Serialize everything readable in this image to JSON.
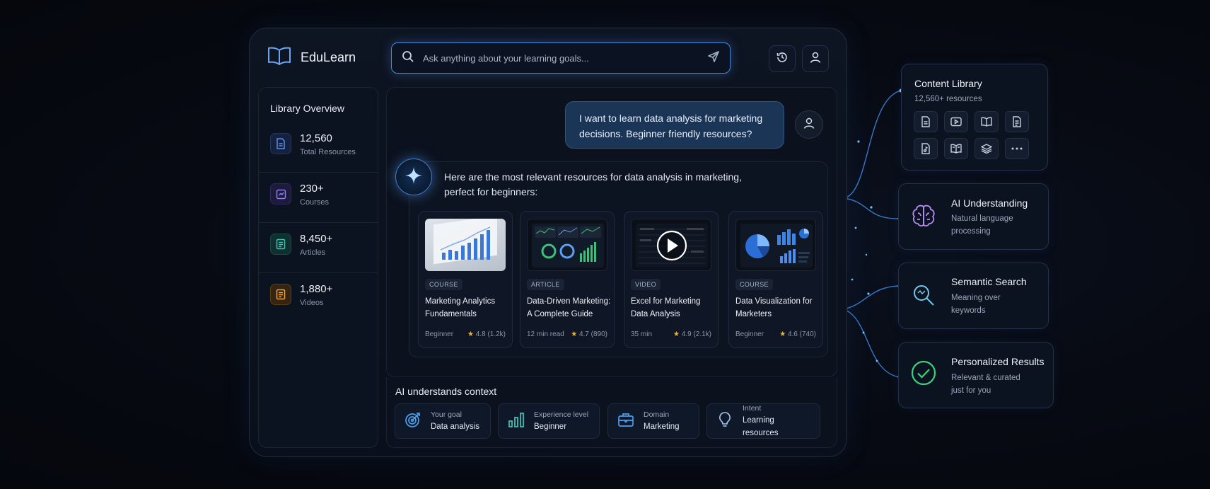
{
  "app": {
    "brand": "EduLearn",
    "search": {
      "placeholder": "Ask anything about your learning goals..."
    }
  },
  "sidebar": {
    "title": "Library Overview",
    "stats": [
      {
        "value": "12,560",
        "label": "Total Resources",
        "color": "#5b8fe0"
      },
      {
        "value": "230+",
        "label": "Courses",
        "color": "#8b7ff0"
      },
      {
        "value": "8,450+",
        "label": "Articles",
        "color": "#3fc0b4"
      },
      {
        "value": "1,880+",
        "label": "Videos",
        "color": "#f0a040"
      }
    ]
  },
  "chat": {
    "user_message": "I want to learn data analysis for marketing decisions. Beginner friendly resources?",
    "ai_message": "Here are the most relevant resources for data analysis in marketing, perfect for beginners:",
    "cards": [
      {
        "type": "COURSE",
        "title": "Marketing Analytics Fundamentals",
        "meta": "Beginner",
        "rating": "4.8",
        "count": "(1.2k)"
      },
      {
        "type": "ARTICLE",
        "title": "Data-Driven Marketing: A Complete Guide",
        "meta": "12 min read",
        "rating": "4.7",
        "count": "(890)"
      },
      {
        "type": "VIDEO",
        "title": "Excel for Marketing Data Analysis",
        "meta": "35 min",
        "rating": "4.9",
        "count": "(2.1k)"
      },
      {
        "type": "COURSE",
        "title": "Data Visualization for Marketers",
        "meta": "Beginner",
        "rating": "4.6",
        "count": "(740)"
      }
    ]
  },
  "context": {
    "title": "AI understands context",
    "chips": [
      {
        "label": "Your goal",
        "value": "Data analysis",
        "icon": "target-icon"
      },
      {
        "label": "Experience level",
        "value": "Beginner",
        "icon": "bar-chart-icon"
      },
      {
        "label": "Domain",
        "value": "Marketing",
        "icon": "briefcase-icon"
      },
      {
        "label": "Intent",
        "value": "Learning resources",
        "icon": "lightbulb-icon"
      }
    ]
  },
  "features": {
    "library": {
      "title": "Content Library",
      "sub": "12,560+ resources"
    },
    "ai": {
      "title": "AI Understanding",
      "sub1": "Natural language",
      "sub2": "processing"
    },
    "semantic": {
      "title": "Semantic Search",
      "sub1": "Meaning over",
      "sub2": "keywords"
    },
    "personal": {
      "title": "Personalized Results",
      "sub1": "Relevant & curated",
      "sub2": "just for you"
    }
  },
  "colors": {
    "accent": "#4a88d8",
    "ai_purple": "#b58cf0",
    "search_cyan": "#6fc8e8",
    "success_green": "#3ed17a",
    "star": "#f2b632"
  }
}
